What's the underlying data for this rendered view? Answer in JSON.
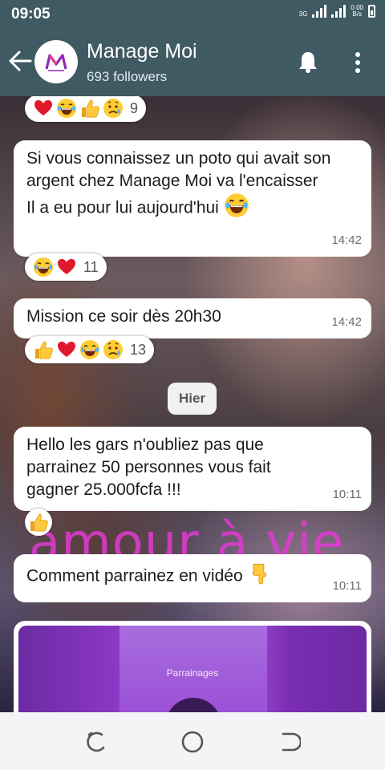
{
  "status": {
    "time": "09:05",
    "network": "3G",
    "speed_value": "0.00",
    "speed_unit": "B/s"
  },
  "header": {
    "title": "Manage Moi",
    "subtitle": "693 followers",
    "avatar_letter": "M"
  },
  "messages": [
    {
      "id": "m1",
      "reactions": {
        "emojis": [
          "heart",
          "laugh",
          "thumbs-up",
          "sad"
        ],
        "count": "9"
      }
    },
    {
      "id": "m2",
      "lines": [
        "Si vous connaissez un poto qui avait son argent chez Manage Moi va l'encaisser",
        "Il a eu pour lui aujourd'hui"
      ],
      "emoji": "laugh",
      "time": "14:42",
      "reactions": {
        "emojis": [
          "laugh",
          "heart"
        ],
        "count": "11"
      }
    },
    {
      "id": "m3",
      "text": "Mission ce soir dès 20h30",
      "time": "14:42",
      "reactions": {
        "emojis": [
          "thumbs-up",
          "heart",
          "laugh",
          "sad"
        ],
        "count": "13"
      }
    },
    {
      "id": "m4",
      "text": "Hello les gars n'oubliez pas que parrainez 50 personnes vous fait gagner 25.000fcfa !!!",
      "time": "10:11",
      "reactions": {
        "emojis": [
          "thumbs-up"
        ]
      }
    },
    {
      "id": "m5",
      "text": "Comment parrainez en vidéo",
      "emoji": "pointing-down",
      "time": "10:11"
    }
  ],
  "date_divider": "Hier",
  "video": {
    "label": "Parrainages"
  },
  "wallpaper_text": "amour à vie",
  "colors": {
    "header": "#3f5a63",
    "bubble": "#ffffff",
    "video_accent": "#8a39c5"
  }
}
